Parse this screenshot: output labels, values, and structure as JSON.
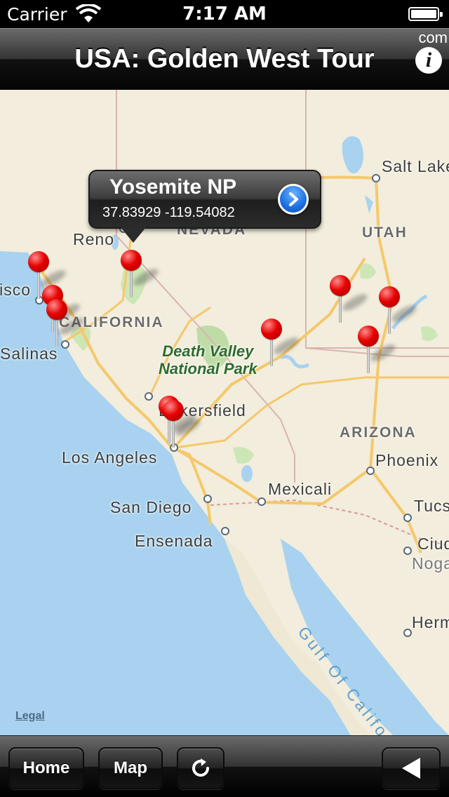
{
  "status_bar": {
    "carrier": "Carrier",
    "time": "7:17 AM"
  },
  "nav": {
    "title": "USA: Golden West Tour",
    "corner_text": "com",
    "info_icon": "info-icon",
    "info_glyph": "i"
  },
  "map": {
    "state_labels": [
      "NEVADA",
      "UTAH",
      "CALIFORNIA",
      "ARIZONA"
    ],
    "city_labels": [
      "Reno",
      "Salt Lake",
      "San Francisco",
      "Salinas",
      "Bakersfield",
      "Los Angeles",
      "Phoenix",
      "Mexicali",
      "San Diego",
      "Tucson",
      "Ensenada",
      "Ciudad",
      "Nogales",
      "Hermosillo"
    ],
    "park_label": "Death Valley\nNational Park",
    "sea_label": "Gulf Of California",
    "legal": "Legal",
    "pin_count": 11,
    "colors": {
      "land": "#f2eddc",
      "water": "#a8d2ef",
      "park": "#bfdca6",
      "pin": "#e60000",
      "highway": "#f5c86a"
    }
  },
  "callout": {
    "title": "Yosemite NP",
    "coordinates": "37.83929 -119.54082",
    "disclosure_icon": "chevron-right-icon"
  },
  "toolbar": {
    "home": "Home",
    "map": "Map",
    "refresh_icon": "refresh-icon",
    "back_icon": "back-arrow-icon"
  }
}
